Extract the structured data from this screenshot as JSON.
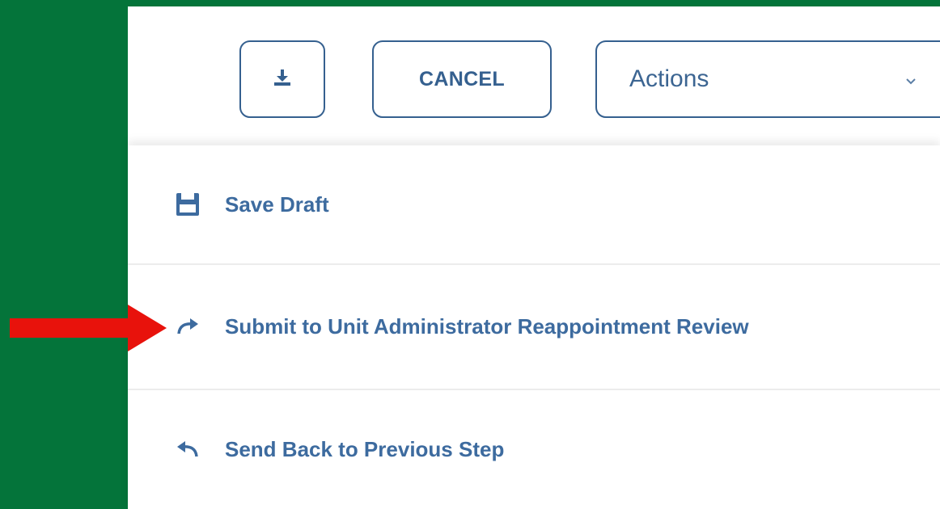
{
  "toolbar": {
    "download_icon": "download-icon",
    "cancel_label": "CANCEL",
    "actions_label": "Actions",
    "actions_chevron_icon": "chevron-down-icon"
  },
  "menu": {
    "items": [
      {
        "label": "Save Draft",
        "icon": "save-icon"
      },
      {
        "label": "Submit to Unit Administrator Reappointment Review",
        "icon": "redo-arrow-icon"
      },
      {
        "label": "Send Back to Previous Step",
        "icon": "undo-arrow-icon"
      }
    ]
  },
  "annotation": {
    "arrow_icon": "red-pointer-arrow-icon",
    "arrow_color": "#e8120c"
  },
  "colors": {
    "background": "#04743a",
    "accent": "#35608f",
    "menu_text": "#3d6b9f"
  }
}
